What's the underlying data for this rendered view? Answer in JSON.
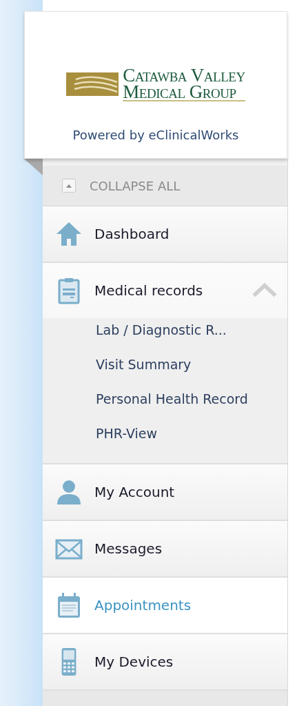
{
  "logo": {
    "line_1": "Catawba Valley",
    "line_2": "Medical Group",
    "tagline": "Powered by eClinicalWorks"
  },
  "collapse_all": {
    "label": "COLLAPSE ALL"
  },
  "menu": [
    {
      "kind": "house",
      "label": "Dashboard",
      "selected": false
    },
    {
      "kind": "clipboard",
      "label": "Medical records",
      "selected": false,
      "expanded": true,
      "children": [
        {
          "label": "Lab / Diagnostic R..."
        },
        {
          "label": "Visit Summary"
        },
        {
          "label": "Personal Health Record"
        },
        {
          "label": "PHR-View"
        }
      ]
    },
    {
      "kind": "person",
      "label": "My Account",
      "selected": false
    },
    {
      "kind": "envelope",
      "label": "Messages",
      "selected": false
    },
    {
      "kind": "calendar",
      "label": "Appointments",
      "selected": true
    },
    {
      "kind": "phone",
      "label": "My Devices",
      "selected": false
    }
  ]
}
